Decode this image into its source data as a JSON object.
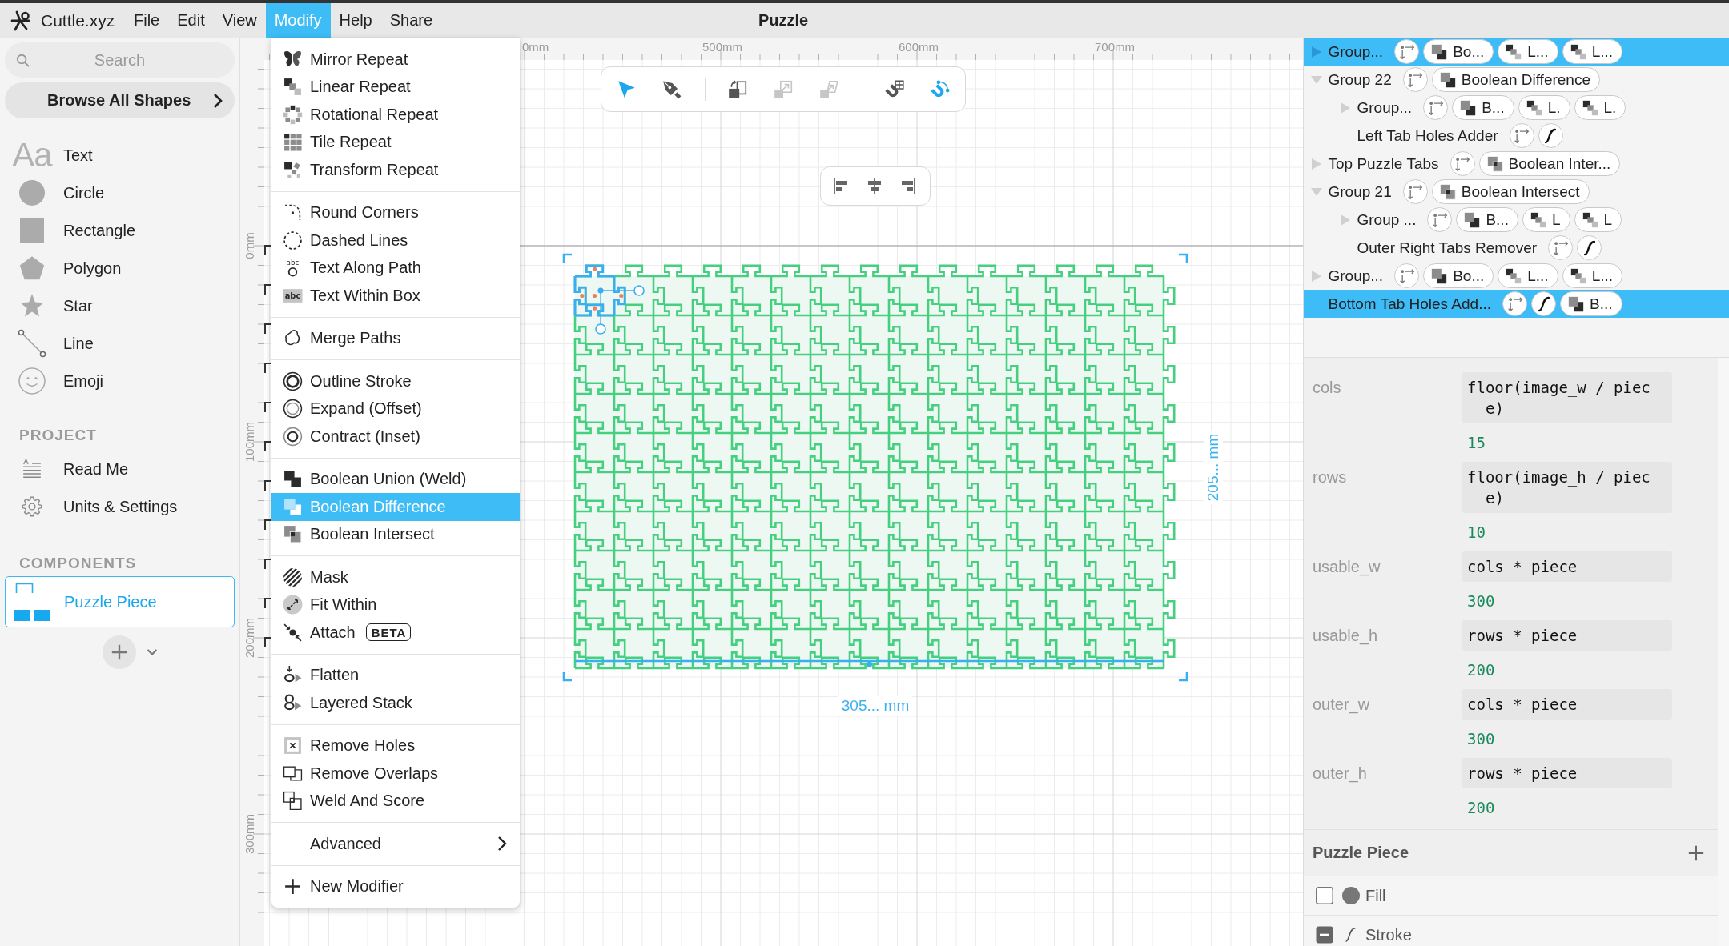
{
  "menubar": {
    "app_name": "Cuttle.xyz",
    "menus": [
      {
        "label": "File",
        "selected": false
      },
      {
        "label": "Edit",
        "selected": false
      },
      {
        "label": "View",
        "selected": false
      },
      {
        "label": "Modify",
        "selected": true
      },
      {
        "label": "Help",
        "selected": false
      },
      {
        "label": "Share",
        "selected": false
      }
    ],
    "document_title": "Puzzle"
  },
  "sidebar": {
    "search": {
      "placeholder": "Search"
    },
    "browse_button": "Browse All Shapes",
    "shapes": [
      {
        "kind": "text",
        "glyph": "Aa",
        "label": "Text"
      },
      {
        "kind": "circle",
        "label": "Circle"
      },
      {
        "kind": "rectangle",
        "label": "Rectangle"
      },
      {
        "kind": "polygon",
        "label": "Polygon"
      },
      {
        "kind": "star",
        "label": "Star"
      },
      {
        "kind": "line",
        "label": "Line"
      },
      {
        "kind": "emoji",
        "label": "Emoji"
      }
    ],
    "project": {
      "heading": "PROJECT",
      "items": [
        {
          "kind": "readme",
          "label": "Read Me"
        },
        {
          "kind": "settings",
          "label": "Units & Settings"
        }
      ]
    },
    "components": {
      "heading": "COMPONENTS",
      "items": [
        {
          "label": "Puzzle Piece",
          "selected": true
        }
      ]
    }
  },
  "modify_menu": [
    [
      {
        "kind": "mirror",
        "label": "Mirror Repeat",
        "selected": false
      },
      {
        "kind": "linear",
        "label": "Linear Repeat",
        "selected": false
      },
      {
        "kind": "rotational",
        "label": "Rotational Repeat",
        "selected": false
      },
      {
        "kind": "tile",
        "label": "Tile Repeat",
        "selected": false
      },
      {
        "kind": "transform",
        "label": "Transform Repeat",
        "selected": false
      }
    ],
    [
      {
        "kind": "corners",
        "label": "Round Corners",
        "selected": false
      },
      {
        "kind": "dashed",
        "label": "Dashed Lines",
        "selected": false
      },
      {
        "kind": "textpath",
        "glyph": "abc",
        "label": "Text Along Path",
        "selected": false
      },
      {
        "kind": "textbox",
        "glyph": "abc",
        "label": "Text Within Box",
        "selected": false
      }
    ],
    [
      {
        "kind": "merge",
        "label": "Merge Paths",
        "selected": false
      }
    ],
    [
      {
        "kind": "outline",
        "label": "Outline Stroke",
        "selected": false
      },
      {
        "kind": "expand",
        "label": "Expand (Offset)",
        "selected": false
      },
      {
        "kind": "contract",
        "label": "Contract (Inset)",
        "selected": false
      }
    ],
    [
      {
        "kind": "union",
        "label": "Boolean Union (Weld)",
        "selected": false
      },
      {
        "kind": "difference",
        "label": "Boolean Difference",
        "selected": true
      },
      {
        "kind": "intersect",
        "label": "Boolean Intersect",
        "selected": false
      }
    ],
    [
      {
        "kind": "mask",
        "label": "Mask",
        "selected": false
      },
      {
        "kind": "fit",
        "label": "Fit Within",
        "selected": false
      },
      {
        "kind": "attach",
        "label": "Attach",
        "badge": "BETA",
        "selected": false
      }
    ],
    [
      {
        "kind": "flatten",
        "label": "Flatten",
        "selected": false
      },
      {
        "kind": "stack",
        "label": "Layered Stack",
        "selected": false
      }
    ],
    [
      {
        "kind": "holes",
        "label": "Remove Holes",
        "selected": false
      },
      {
        "kind": "overlaps",
        "label": "Remove Overlaps",
        "selected": false
      },
      {
        "kind": "weld",
        "label": "Weld And Score",
        "selected": false
      }
    ],
    [
      {
        "kind": "submenu",
        "label": "Advanced",
        "selected": false
      }
    ],
    [
      {
        "kind": "add",
        "label": "New Modifier",
        "selected": false
      }
    ]
  ],
  "canvas": {
    "rulers": {
      "top": [
        "0mm",
        "500mm",
        "600mm",
        "700mm"
      ],
      "left": [
        "0mm",
        "100mm",
        "200mm",
        "300mm"
      ]
    },
    "toolbar": [
      [
        {
          "kind": "select",
          "active": true,
          "disabled": false
        },
        {
          "kind": "pen",
          "active": false,
          "disabled": false
        }
      ],
      [
        {
          "kind": "rotate",
          "active": false,
          "disabled": false
        },
        {
          "kind": "scale",
          "active": false,
          "disabled": true
        },
        {
          "kind": "skew",
          "active": false,
          "disabled": true
        }
      ],
      [
        {
          "kind": "gridsnap",
          "active": false,
          "disabled": false
        },
        {
          "kind": "pathsnap",
          "active": true,
          "disabled": false
        }
      ]
    ],
    "align_toolbar": [
      {
        "kind": "left"
      },
      {
        "kind": "center"
      },
      {
        "kind": "right"
      }
    ],
    "dimensions": {
      "width": "305... mm",
      "height": "205... mm"
    }
  },
  "layers": [
    {
      "name": "Group...",
      "expanded": false,
      "selected": true,
      "modifiers": [
        {
          "kind": "transform"
        },
        {
          "kind": "difference",
          "label": "Bo..."
        },
        {
          "kind": "linear",
          "label": "L..."
        },
        {
          "kind": "linear",
          "label": "L..."
        }
      ]
    },
    {
      "name": "Group 22",
      "expanded": true,
      "selected": false,
      "modifiers": [
        {
          "kind": "transform"
        },
        {
          "kind": "difference",
          "label": "Boolean Difference"
        }
      ],
      "children": [
        {
          "name": "Group...",
          "expanded": false,
          "selected": false,
          "modifiers": [
            {
              "kind": "transform"
            },
            {
              "kind": "difference",
              "label": "B..."
            },
            {
              "kind": "linear",
              "label": "L."
            },
            {
              "kind": "linear",
              "label": "L."
            }
          ]
        },
        {
          "name": "Left Tab Holes Adder",
          "selected": false,
          "modifiers": [
            {
              "kind": "transform"
            },
            {
              "kind": "path"
            }
          ]
        }
      ]
    },
    {
      "name": "Top Puzzle Tabs",
      "expanded": false,
      "selected": false,
      "modifiers": [
        {
          "kind": "transform"
        },
        {
          "kind": "intersect",
          "label": "Boolean Inter..."
        }
      ]
    },
    {
      "name": "Group 21",
      "expanded": true,
      "selected": false,
      "modifiers": [
        {
          "kind": "transform"
        },
        {
          "kind": "intersect",
          "label": "Boolean Intersect"
        }
      ],
      "children": [
        {
          "name": "Group ...",
          "expanded": false,
          "selected": false,
          "modifiers": [
            {
              "kind": "transform"
            },
            {
              "kind": "difference",
              "label": "B..."
            },
            {
              "kind": "linear",
              "label": "L"
            },
            {
              "kind": "linear",
              "label": "L"
            }
          ]
        },
        {
          "name": "Outer Right Tabs Remover",
          "selected": false,
          "modifiers": [
            {
              "kind": "transform"
            },
            {
              "kind": "path"
            }
          ]
        }
      ]
    },
    {
      "name": "Group...",
      "expanded": false,
      "selected": false,
      "modifiers": [
        {
          "kind": "transform"
        },
        {
          "kind": "difference",
          "label": "Bo..."
        },
        {
          "kind": "linear",
          "label": "L..."
        },
        {
          "kind": "linear",
          "label": "L..."
        }
      ]
    },
    {
      "name": "Bottom Tab Holes Add...",
      "selected": true,
      "modifiers": [
        {
          "kind": "transform"
        },
        {
          "kind": "path"
        },
        {
          "kind": "difference",
          "label": "B..."
        }
      ]
    }
  ],
  "parameters": [
    {
      "name": "cols",
      "expression": "floor(image_w / piece)",
      "value": "15"
    },
    {
      "name": "rows",
      "expression": "floor(image_h / piece)",
      "value": "10"
    },
    {
      "name": "usable_w",
      "expression": "cols * piece",
      "value": "300"
    },
    {
      "name": "usable_h",
      "expression": "rows * piece",
      "value": "200"
    },
    {
      "name": "outer_w",
      "expression": "cols * piece",
      "value": "300"
    },
    {
      "name": "outer_h",
      "expression": "rows * piece",
      "value": "200"
    }
  ],
  "component_panel": {
    "title": "Puzzle Piece",
    "styles": [
      {
        "kind": "fill",
        "label": "Fill",
        "checked": false,
        "mixed": false
      },
      {
        "kind": "stroke",
        "label": "Stroke",
        "checked": true,
        "mixed": true
      }
    ]
  }
}
